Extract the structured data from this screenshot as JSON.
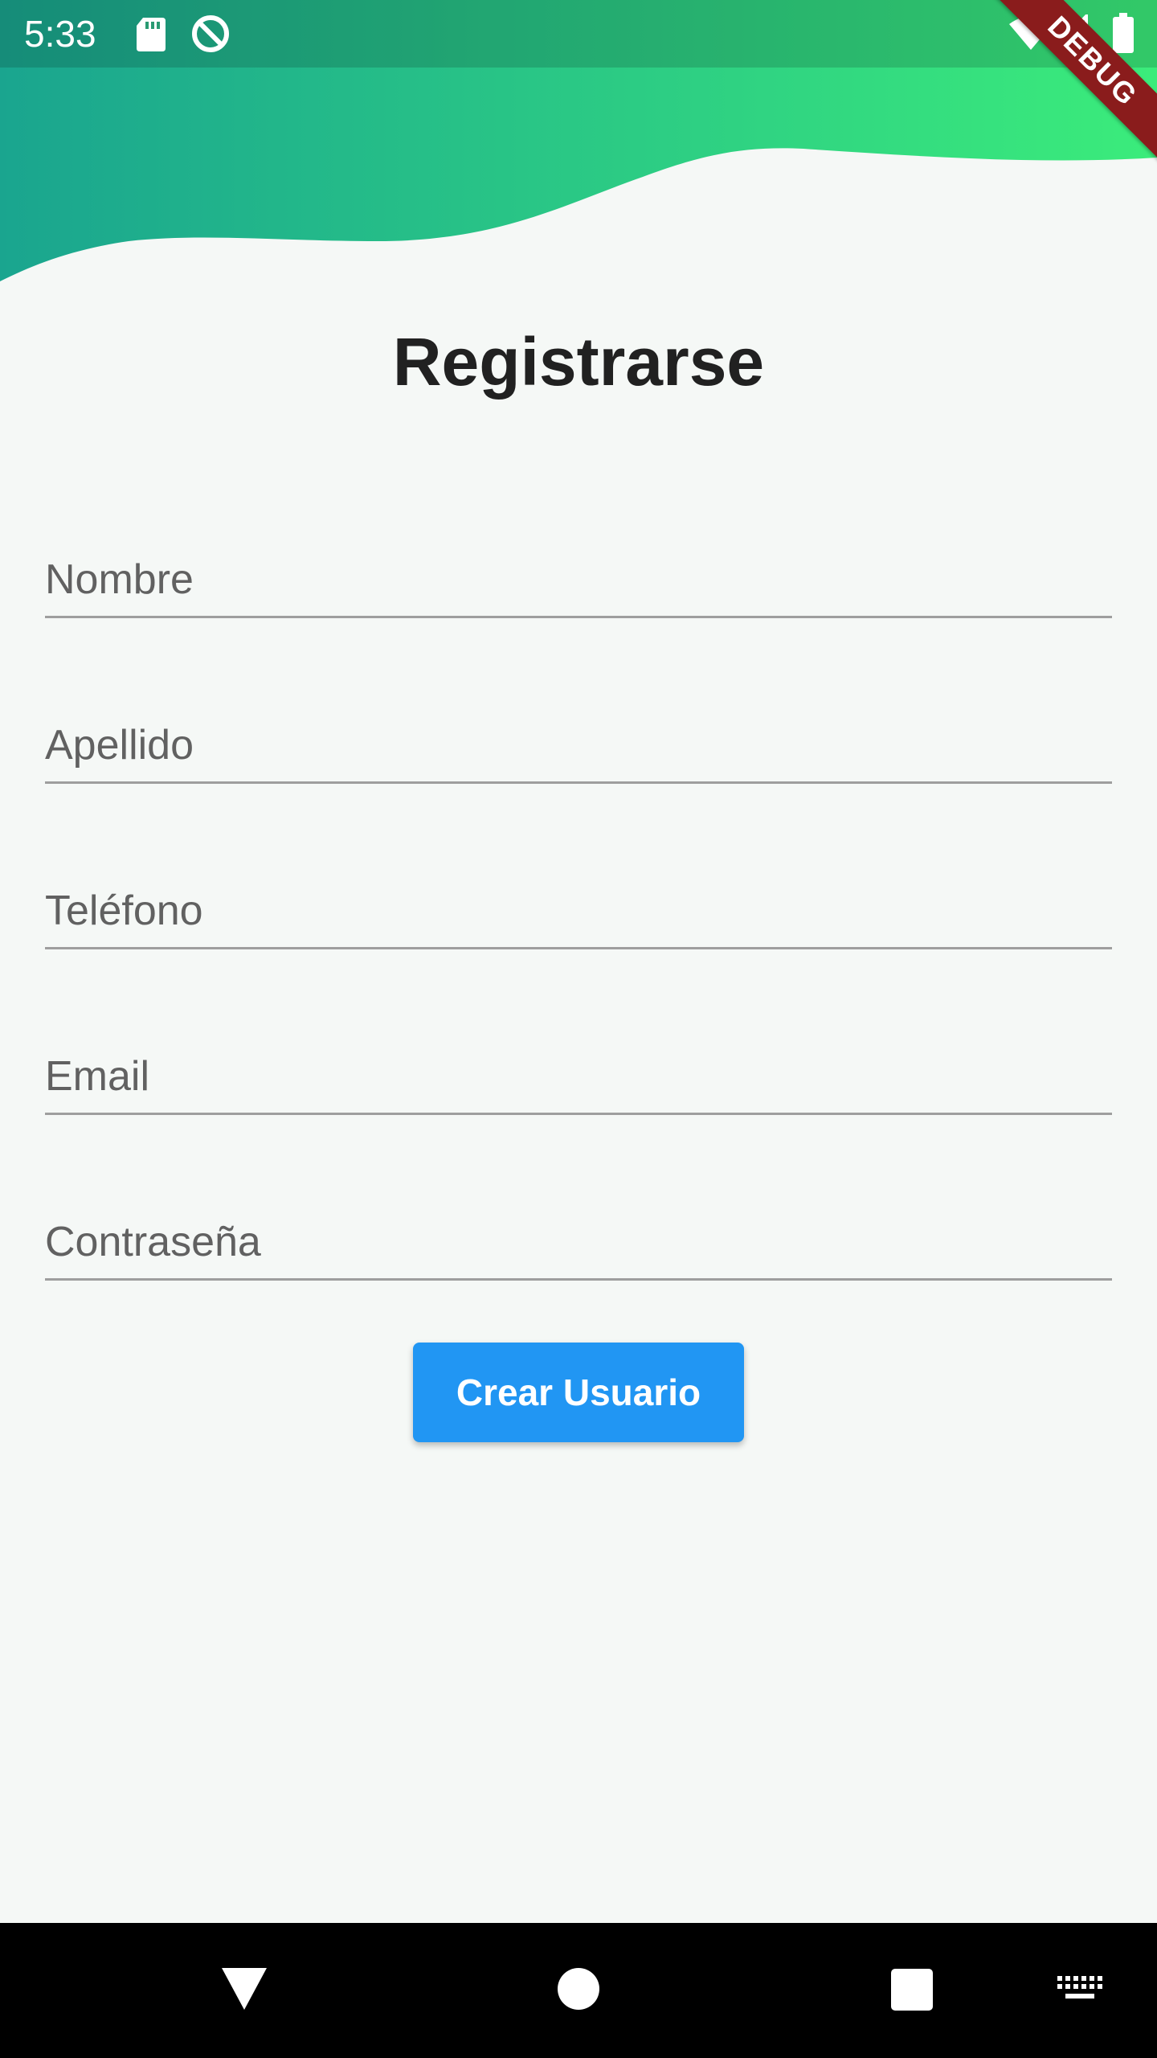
{
  "status_bar": {
    "time": "5:33",
    "icons": [
      "sd-card-icon",
      "data-saver-icon",
      "wifi-icon",
      "signal-icon",
      "battery-icon"
    ]
  },
  "debug_banner": "DEBUG",
  "header": {
    "gradient_start": "#1aa58f",
    "gradient_end": "#3bec7b"
  },
  "page": {
    "title": "Registrarse"
  },
  "form": {
    "fields": [
      {
        "placeholder": "Nombre",
        "value": ""
      },
      {
        "placeholder": "Apellido",
        "value": ""
      },
      {
        "placeholder": "Teléfono",
        "value": ""
      },
      {
        "placeholder": "Email",
        "value": ""
      },
      {
        "placeholder": "Contraseña",
        "value": ""
      }
    ],
    "submit_label": "Crear Usuario",
    "submit_color": "#2196f3"
  },
  "nav_bar": {
    "buttons": [
      "back-icon",
      "home-icon",
      "recents-icon",
      "keyboard-icon"
    ]
  }
}
